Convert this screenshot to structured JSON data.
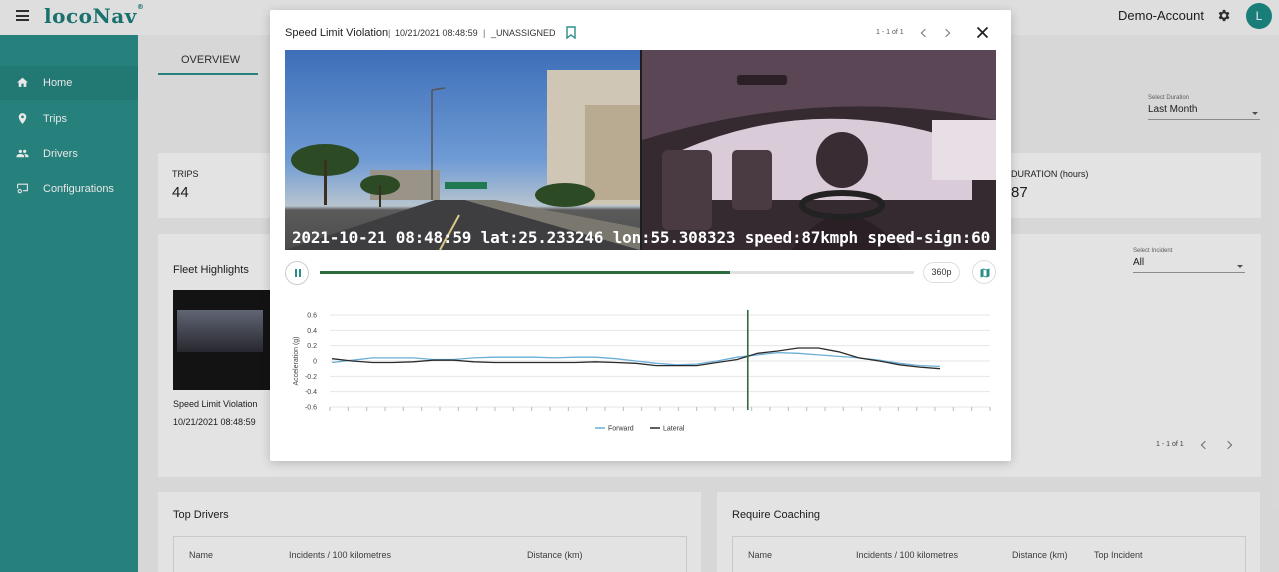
{
  "header": {
    "logo": "locoNav",
    "logo_mark": "®",
    "account": "Demo-Account",
    "avatar_initial": "L"
  },
  "sidebar": {
    "items": [
      {
        "label": "Home",
        "icon": "home-icon"
      },
      {
        "label": "Trips",
        "icon": "location-pin-icon"
      },
      {
        "label": "Drivers",
        "icon": "people-icon"
      },
      {
        "label": "Configurations",
        "icon": "settings-screen-icon"
      }
    ]
  },
  "tabs": {
    "overview": "OVERVIEW"
  },
  "duration": {
    "label": "Select Duration",
    "value": "Last Month"
  },
  "stats": {
    "trips_label": "TRIPS",
    "trips_value": "44",
    "duration_label": "DURATION (hours)",
    "duration_value": "87"
  },
  "fleet": {
    "title": "Fleet Highlights",
    "caption": "Speed Limit Violation",
    "time": "10/21/2021 08:48:59"
  },
  "incident": {
    "label": "Select Incident",
    "value": "All"
  },
  "bg_pager": "1 - 1 of 1",
  "top_drivers": {
    "title": "Top Drivers",
    "columns": [
      "Name",
      "Incidents / 100 kilometres",
      "Distance (km)"
    ]
  },
  "coaching": {
    "title": "Require Coaching",
    "columns": [
      "Name",
      "Incidents / 100 kilometres",
      "Distance (km)",
      "Top Incident"
    ]
  },
  "modal": {
    "title": "Speed Limit Violation",
    "sep": "|",
    "timestamp": "10/21/2021 08:48:59",
    "assignee": "_UNASSIGNED",
    "pager": "1 - 1 of 1",
    "video_overlay": "2021-10-21 08:48:59 lat:25.233246 lon:55.308323 speed:87kmph speed-sign:60",
    "quality": "360p",
    "progress": 0.69
  },
  "chart_data": {
    "type": "line",
    "ylabel": "Acceleration (g)",
    "xlabel": "",
    "ylim": [
      -0.6,
      0.6
    ],
    "yticks": [
      0.6,
      0.4,
      0.2,
      0,
      -0.2,
      -0.4,
      -0.6
    ],
    "grid": true,
    "legend": "bottom-center",
    "marker_fraction": 0.633,
    "series": [
      {
        "name": "Forward",
        "color": "#6aaed6",
        "values": [
          -0.02,
          0.01,
          0.04,
          0.04,
          0.04,
          0.02,
          0.02,
          0.04,
          0.05,
          0.05,
          0.05,
          0.04,
          0.05,
          0.05,
          0.03,
          0.0,
          -0.03,
          -0.05,
          -0.04,
          0.0,
          0.05,
          0.08,
          0.11,
          0.1,
          0.08,
          0.06,
          0.04,
          0.01,
          -0.03,
          -0.06,
          -0.07
        ]
      },
      {
        "name": "Lateral",
        "color": "#2b2b2b",
        "values": [
          0.03,
          0.0,
          -0.02,
          -0.02,
          -0.01,
          0.01,
          0.01,
          -0.01,
          -0.02,
          -0.02,
          -0.02,
          -0.02,
          -0.02,
          -0.01,
          -0.02,
          -0.03,
          -0.06,
          -0.06,
          -0.06,
          -0.02,
          0.02,
          0.1,
          0.13,
          0.17,
          0.17,
          0.12,
          0.04,
          0.0,
          -0.05,
          -0.08,
          -0.1
        ]
      }
    ]
  }
}
